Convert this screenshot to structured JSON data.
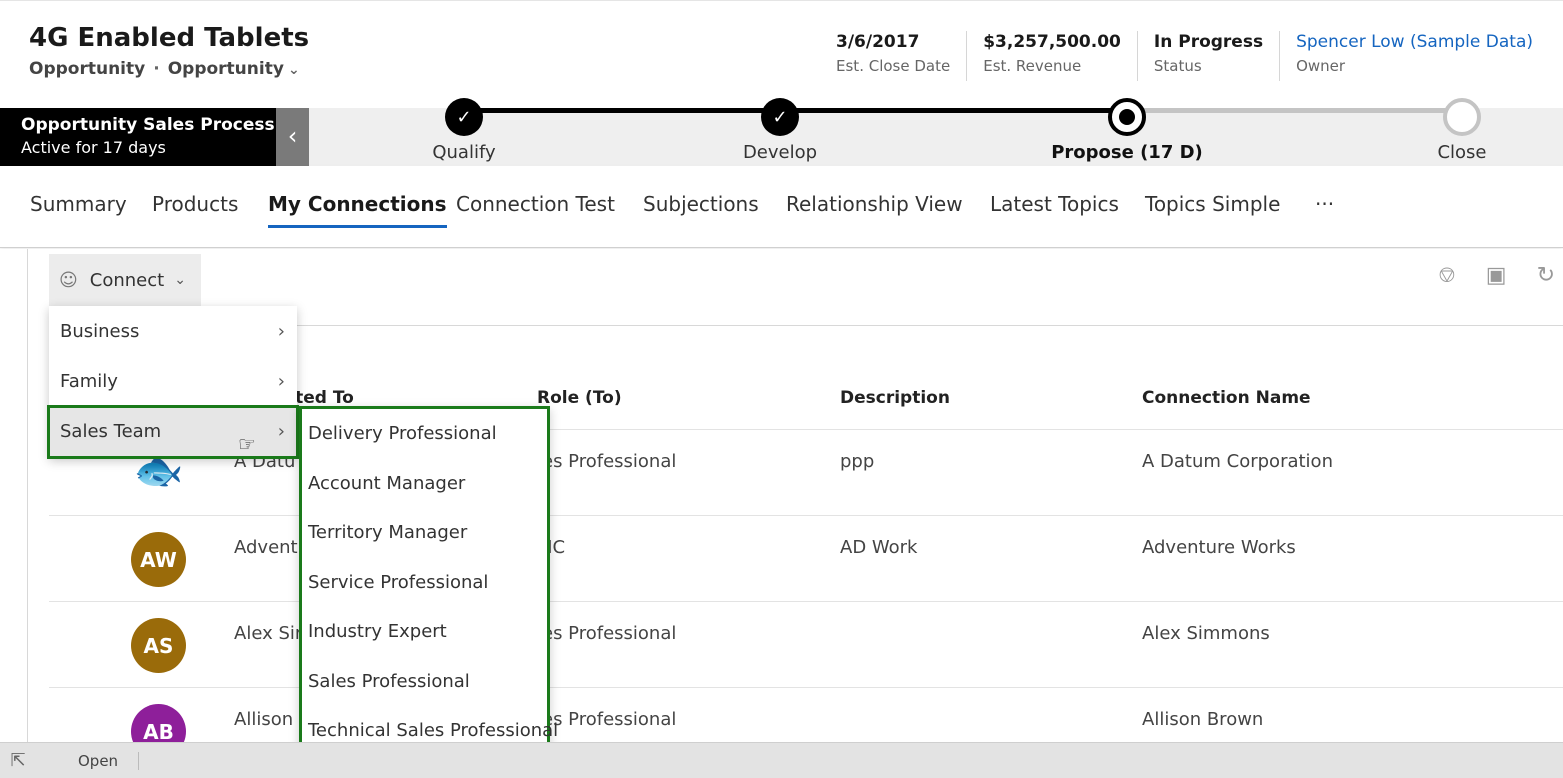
{
  "header": {
    "title": "4G Enabled Tablets",
    "entity": "Opportunity",
    "separator": "·",
    "form": "Opportunity",
    "fields": [
      {
        "value": "3/6/2017",
        "label": "Est. Close Date"
      },
      {
        "value": "$3,257,500.00",
        "label": "Est. Revenue"
      },
      {
        "value": "In Progress",
        "label": "Status"
      },
      {
        "value": "Spencer Low (Sample Data)",
        "label": "Owner"
      }
    ]
  },
  "bpf": {
    "name": "Opportunity Sales Process",
    "active": "Active for 17 days",
    "stages": [
      {
        "name": "Qualify",
        "state": "done"
      },
      {
        "name": "Develop",
        "state": "done"
      },
      {
        "name": "Propose  (17 D)",
        "state": "active"
      },
      {
        "name": "Close",
        "state": "todo"
      }
    ]
  },
  "tabs": [
    "Summary",
    "Products",
    "My Connections",
    "Connection Test",
    "Subjections",
    "Relationship View",
    "Latest Topics",
    "Topics Simple",
    "···"
  ],
  "toolbar": {
    "connect_label": "Connect"
  },
  "table": {
    "headers": [
      "cted To",
      "Role (To)",
      "Description",
      "Connection Name"
    ],
    "rows": [
      {
        "initials": "",
        "color": "#ffffff",
        "connected": "A Datu",
        "role": "les Professional",
        "description": "ppp",
        "name": "A Datum Corporation"
      },
      {
        "initials": "AW",
        "color": "#9a6b0a",
        "connected": "Advent",
        "role": "MC",
        "description": "AD Work",
        "name": "Adventure Works"
      },
      {
        "initials": "AS",
        "color": "#9a6b0a",
        "connected": "Alex Sir",
        "role": "les Professional",
        "description": "",
        "name": "Alex Simmons"
      },
      {
        "initials": "AB",
        "color": "#8e1f9a",
        "connected": "Allison",
        "role": "les Professional",
        "description": "",
        "name": "Allison Brown"
      }
    ]
  },
  "menu": {
    "items": [
      "Business",
      "Family",
      "Sales Team"
    ],
    "submenu": [
      "Delivery Professional",
      "Account Manager",
      "Territory Manager",
      "Service Professional",
      "Industry Expert",
      "Sales Professional",
      "Technical Sales Professional"
    ]
  },
  "status": {
    "open_label": "Open"
  }
}
